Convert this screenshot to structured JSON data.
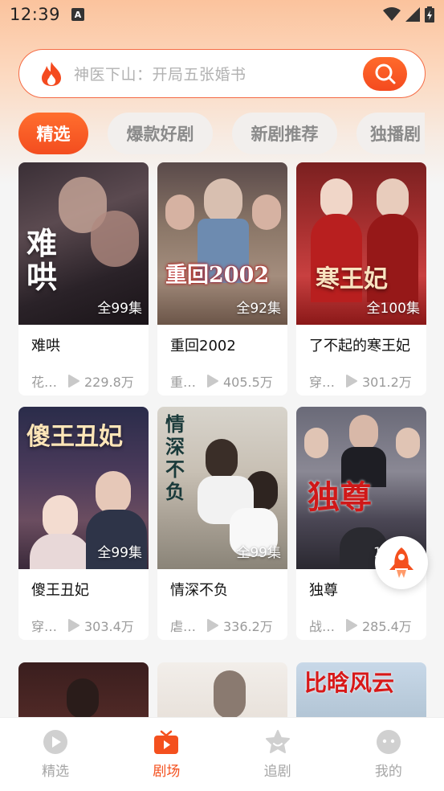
{
  "status_bar": {
    "time": "12:39",
    "notification_icon": "A"
  },
  "search": {
    "placeholder": "神医下山：开局五张婚书"
  },
  "tabs": [
    {
      "label": "精选",
      "active": true
    },
    {
      "label": "爆款好剧",
      "active": false
    },
    {
      "label": "新剧推荐",
      "active": false
    },
    {
      "label": "独播剧",
      "active": false
    }
  ],
  "cards": [
    {
      "title": "难哄",
      "episodes": "",
      "tag": "花…",
      "plays": "229.8万",
      "poster_text": "难哄"
    },
    {
      "title": "重回2002",
      "episodes": "全92集",
      "tag": "重…",
      "plays": "405.5万",
      "poster_text": "重回2002"
    },
    {
      "title": "了不起的寒王妃",
      "episodes": "全100集",
      "tag": "穿…",
      "plays": "301.2万",
      "poster_text": "寒王妃"
    },
    {
      "title": "傻王丑妃",
      "episodes": "全99集",
      "tag": "穿…",
      "plays": "303.4万",
      "poster_text": "傻王丑妃"
    },
    {
      "title": "情深不负",
      "episodes": "全99集",
      "tag": "虐…",
      "plays": "336.2万",
      "poster_text": "情深不负"
    },
    {
      "title": "独尊",
      "episodes": "",
      "tag": "战…",
      "plays": "285.4万",
      "poster_text": "独尊"
    },
    {
      "title": "",
      "episodes": "",
      "tag": "",
      "plays": "",
      "poster_text": ""
    },
    {
      "title": "",
      "episodes": "",
      "tag": "",
      "plays": "",
      "poster_text": ""
    },
    {
      "title": "",
      "episodes": "",
      "tag": "",
      "plays": "",
      "poster_text": "比晗风云"
    }
  ],
  "card_1_badge": "全99集",
  "card_6_badge_partial": "1",
  "nav": [
    {
      "label": "精选",
      "icon": "play-circle-icon",
      "active": false
    },
    {
      "label": "剧场",
      "icon": "tv-icon",
      "active": true
    },
    {
      "label": "追剧",
      "icon": "star-icon",
      "active": false
    },
    {
      "label": "我的",
      "icon": "profile-icon",
      "active": false
    }
  ],
  "colors": {
    "accent": "#f4501e",
    "tab_active": "#f34d1f",
    "search_border": "#f56b45"
  }
}
